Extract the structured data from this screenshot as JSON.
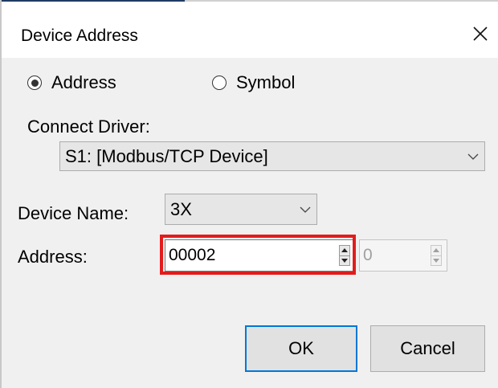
{
  "dialog": {
    "title": "Device Address",
    "close_glyph": "✕"
  },
  "mode": {
    "options": [
      {
        "label": "Address",
        "selected": true
      },
      {
        "label": "Symbol",
        "selected": false
      }
    ]
  },
  "connect_driver": {
    "label": "Connect Driver:",
    "value": "S1: [Modbus/TCP Device]"
  },
  "device_name": {
    "label": "Device Name:",
    "value": "3X"
  },
  "address": {
    "label": "Address:",
    "value": "00002",
    "bit_value": "0"
  },
  "buttons": {
    "ok": "OK",
    "cancel": "Cancel"
  },
  "colors": {
    "highlight": "#e21c1c",
    "default_button_border": "#0078d7"
  },
  "icons": [
    "close-icon",
    "chevron-down-icon",
    "spin-up-icon",
    "spin-down-icon"
  ]
}
